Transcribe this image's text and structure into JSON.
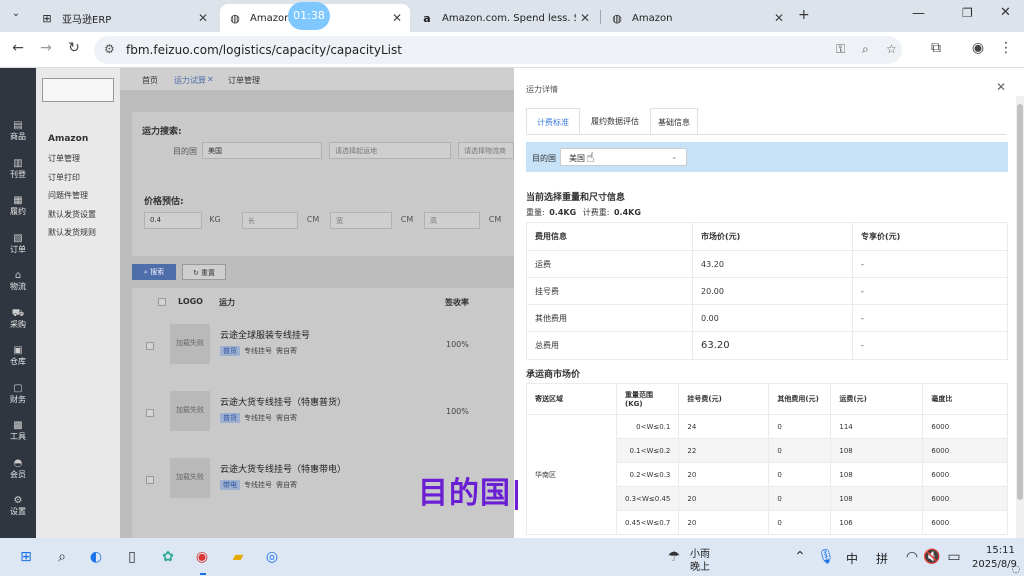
{
  "browser": {
    "tabs": [
      {
        "title": "亚马逊ERP",
        "icon": "erp-icon"
      },
      {
        "title": "Amazon",
        "icon": "globe-icon"
      },
      {
        "title": "Amazon.com. Spend less. Sm",
        "icon": "amazon-icon"
      },
      {
        "title": "Amazon",
        "icon": "globe-icon"
      }
    ],
    "timer": "01:38",
    "url": "fbm.feizuo.com/logistics/capacity/capacityList"
  },
  "sidebar": {
    "items": [
      "商品",
      "刊登",
      "履约",
      "订单",
      "物流",
      "采购",
      "仓库",
      "财务",
      "工具",
      "会员",
      "设置"
    ]
  },
  "submenu": {
    "heading": "Amazon",
    "items": [
      "订单管理",
      "订单打印",
      "问题件管理",
      "默认发货设置",
      "默认发货规则"
    ]
  },
  "main": {
    "page_tabs": [
      "首页",
      "运力试算",
      "订单管理"
    ],
    "search": {
      "title": "运力搜索:",
      "dest_label": "目的国",
      "dest_value": "美国",
      "origin_placeholder": "请选择起运地",
      "channel_placeholder": "请选择物流商"
    },
    "price": {
      "title": "价格预估:",
      "weight_value": "0.4",
      "weight_unit": "KG",
      "length_placeholder": "长",
      "width_placeholder": "宽",
      "height_placeholder": "高",
      "dim_unit": "CM"
    },
    "buttons": {
      "search": "搜索",
      "reset": "重置"
    },
    "list": {
      "headers": [
        "LOGO",
        "运力",
        "签收率"
      ],
      "rows": [
        {
          "logo": "加载失败",
          "name": "云途全球服装专线挂号",
          "tag": "普货",
          "tag2": "专线挂号",
          "tag3": "需自寄",
          "rate": "100%"
        },
        {
          "logo": "加载失败",
          "name": "云途大货专线挂号（特惠普货）",
          "tag": "普货",
          "tag2": "专线挂号",
          "tag3": "需自寄",
          "rate": "100%"
        },
        {
          "logo": "加载失败",
          "name": "云途大货专线挂号（特惠带电）",
          "tag": "带电",
          "tag2": "专线挂号",
          "tag3": "需自寄",
          "rate": ""
        }
      ]
    }
  },
  "panel": {
    "title": "运力详情",
    "tabs": [
      "计费标准",
      "履约数据评估",
      "基础信息"
    ],
    "dest_label": "目的国",
    "dest_value": "美国",
    "section1": "当前选择重量和尺寸信息",
    "weight_label": "重量:",
    "weight_value": "0.4KG",
    "billing_label": "计费重:",
    "billing_value": "0.4KG",
    "fee_table": {
      "headers": [
        "费用信息",
        "市场价(元)",
        "专享价(元)"
      ],
      "rows": [
        [
          "运费",
          "43.20",
          "-"
        ],
        [
          "挂号费",
          "20.00",
          "-"
        ],
        [
          "其他费用",
          "0.00",
          "-"
        ],
        [
          "总费用",
          "63.20",
          "-"
        ]
      ]
    },
    "section2": "承运商市场价",
    "rate_table": {
      "headers": [
        "寄送区域",
        "重量范围(KG)",
        "挂号费(元)",
        "其他费用(元)",
        "运费(元)",
        "毫度比"
      ],
      "region": "华南区",
      "rows": [
        [
          "0<W≤0.1",
          "24",
          "0",
          "114",
          "6000"
        ],
        [
          "0.1<W≤0.2",
          "22",
          "0",
          "108",
          "6000"
        ],
        [
          "0.2<W≤0.3",
          "20",
          "0",
          "108",
          "6000"
        ],
        [
          "0.3<W≤0.45",
          "20",
          "0",
          "108",
          "6000"
        ],
        [
          "0.45<W≤0.7",
          "20",
          "0",
          "106",
          "6000"
        ]
      ]
    }
  },
  "subtitle": "目的国|",
  "taskbar": {
    "weather": "小雨",
    "weather_sub": "晚上",
    "ime1": "中",
    "ime2": "拼",
    "time": "15:11",
    "date": "2025/8/9"
  }
}
